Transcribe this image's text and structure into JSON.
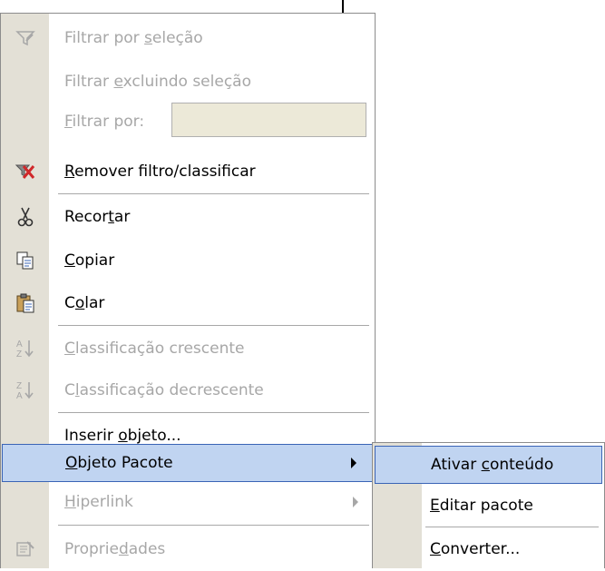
{
  "context_menu": {
    "items": [
      {
        "label": "Filtrar por seleção",
        "parts": [
          "Filtrar por ",
          "s",
          "eleção"
        ],
        "icon": "filter-selection-icon",
        "enabled": false
      },
      {
        "label": "Filtrar excluindo seleção",
        "parts": [
          "Filtrar ",
          "e",
          "xcluindo seleção"
        ],
        "icon": "",
        "enabled": false
      },
      {
        "label": "Filtrar por:",
        "parts": [
          "",
          "F",
          "iltrar por:"
        ],
        "icon": "",
        "enabled": false,
        "input_value": ""
      },
      {
        "label": "Remover filtro/classificar",
        "parts": [
          "",
          "R",
          "emover filtro/classificar"
        ],
        "icon": "remove-filter-icon",
        "enabled": true
      },
      {
        "label": "Recortar",
        "parts": [
          "Recor",
          "t",
          "ar"
        ],
        "icon": "scissors-icon",
        "enabled": true
      },
      {
        "label": "Copiar",
        "parts": [
          "",
          "C",
          "opiar"
        ],
        "icon": "copy-icon",
        "enabled": true
      },
      {
        "label": "Colar",
        "parts": [
          "C",
          "o",
          "lar"
        ],
        "icon": "paste-icon",
        "enabled": true
      },
      {
        "label": "Classificação crescente",
        "parts": [
          "",
          "C",
          "lassificação crescente"
        ],
        "icon": "sort-ascending-icon",
        "enabled": false
      },
      {
        "label": "Classificação decrescente",
        "parts": [
          "C",
          "l",
          "assificação decrescente"
        ],
        "icon": "sort-descending-icon",
        "enabled": false
      },
      {
        "label": "Inserir objeto...",
        "parts": [
          "Inserir ",
          "o",
          "bjeto..."
        ],
        "icon": "",
        "enabled": true
      },
      {
        "label": "Objeto Pacote",
        "parts": [
          "",
          "O",
          "bjeto Pacote"
        ],
        "icon": "",
        "enabled": true,
        "submenu": true,
        "highlighted": true
      },
      {
        "label": "Hiperlink",
        "parts": [
          "",
          "H",
          "iperlink"
        ],
        "icon": "",
        "enabled": false,
        "submenu": true
      },
      {
        "label": "Propriedades",
        "parts": [
          "Proprie",
          "d",
          "ades"
        ],
        "icon": "properties-icon",
        "enabled": false
      }
    ]
  },
  "submenu": {
    "items": [
      {
        "label": "Ativar conteúdo",
        "parts": [
          "Ativar ",
          "c",
          "onteúdo"
        ],
        "highlighted": true
      },
      {
        "label": "Editar pacote",
        "parts": [
          "",
          "E",
          "ditar pacote"
        ]
      },
      {
        "label": "Converter...",
        "parts": [
          "",
          "C",
          "onverter..."
        ]
      }
    ]
  },
  "colors": {
    "gutter": "#e3e0d6",
    "highlight": "#c0d4f1",
    "highlight_border": "#3a64b6",
    "disabled_text": "#a7a7a7"
  }
}
